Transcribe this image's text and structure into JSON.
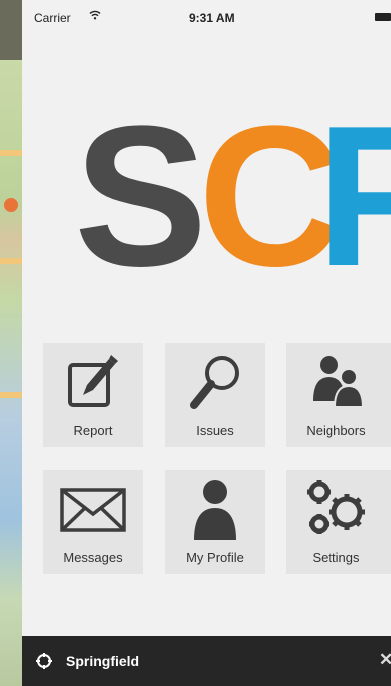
{
  "status_bar": {
    "carrier": "Carrier",
    "time": "9:31 AM"
  },
  "logo": {
    "s": "S",
    "c": "C",
    "f": "F",
    "colors": {
      "s": "#4b4b4b",
      "c": "#f08a1f",
      "f": "#1e9fd6"
    }
  },
  "menu": {
    "items": [
      {
        "label": "Report",
        "icon": "report-icon"
      },
      {
        "label": "Issues",
        "icon": "magnifier-icon"
      },
      {
        "label": "Neighbors",
        "icon": "people-icon"
      },
      {
        "label": "Messages",
        "icon": "envelope-icon"
      },
      {
        "label": "My Profile",
        "icon": "person-icon"
      },
      {
        "label": "Settings",
        "icon": "gears-icon"
      }
    ]
  },
  "footer": {
    "city": "Springfield"
  }
}
